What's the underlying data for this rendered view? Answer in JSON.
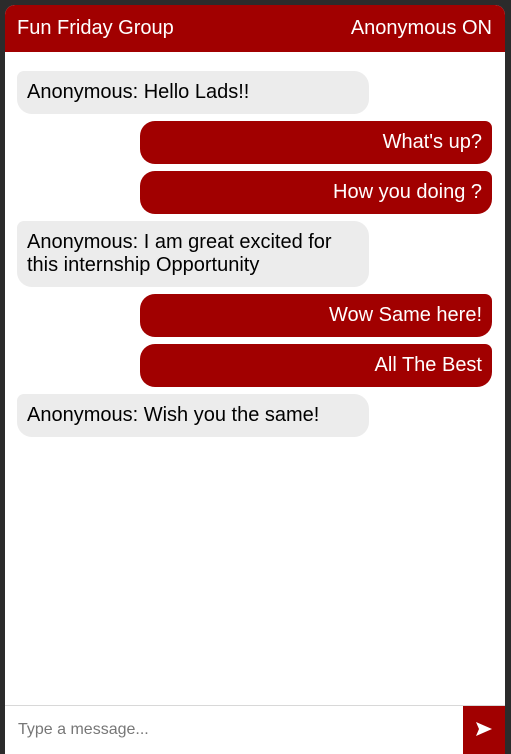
{
  "header": {
    "title": "Fun Friday Group",
    "mode": "Anonymous ON"
  },
  "messages": [
    {
      "direction": "incoming",
      "text": "Anonymous: Hello Lads!!"
    },
    {
      "direction": "outgoing",
      "text": "What's up?"
    },
    {
      "direction": "outgoing",
      "text": "How you doing ?"
    },
    {
      "direction": "incoming",
      "text": "Anonymous: I am great excited for this internship Opportunity"
    },
    {
      "direction": "outgoing",
      "text": "Wow Same here!"
    },
    {
      "direction": "outgoing",
      "text": "All The Best"
    },
    {
      "direction": "incoming",
      "text": "Anonymous: Wish you the same!"
    }
  ],
  "composer": {
    "placeholder": "Type a message...",
    "value": "",
    "send_icon": "send-arrow-icon"
  },
  "colors": {
    "accent": "#a10000",
    "incoming_bubble": "#ececec",
    "background": "#ffffff"
  }
}
